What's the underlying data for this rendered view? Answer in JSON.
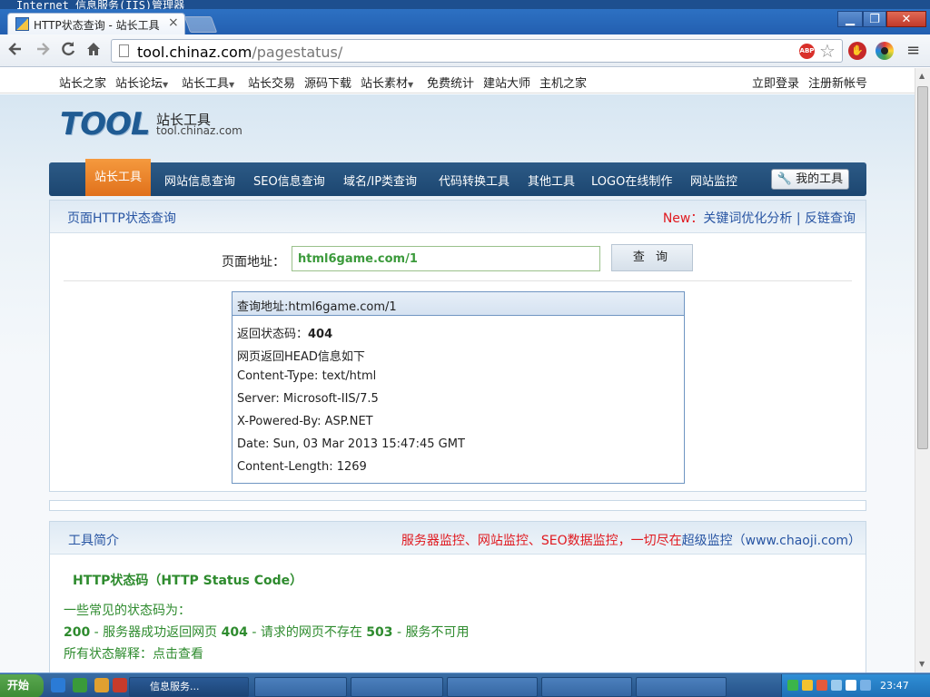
{
  "window": {
    "os_title": "Internet 信息服务(IIS)管理器",
    "minimize": "▁",
    "maximize": "❐",
    "close": "✕"
  },
  "browser": {
    "tab_title": "HTTP状态查询 - 站长工具",
    "tab_close": "×",
    "url_host": "tool.chinaz.com",
    "url_path": "/pagestatus/",
    "abp_label": "ABP",
    "icons": {
      "back": "arrow-left-icon",
      "forward": "arrow-right-icon",
      "reload": "reload-icon",
      "home": "home-icon",
      "bookmark": "star-icon",
      "menu": "menu-icon"
    }
  },
  "topnav": {
    "items": [
      "站长之家",
      "站长论坛",
      "站长工具",
      "站长交易",
      "源码下载",
      "站长素材",
      "免费统计",
      "建站大师",
      "主机之家"
    ],
    "login": "立即登录",
    "register": "注册新帐号"
  },
  "logo": {
    "text": "TOOL",
    "cn": "站长工具",
    "domain": "tool.chinaz.com"
  },
  "mainnav": {
    "active": "站长工具",
    "items": [
      "网站信息查询",
      "SEO信息查询",
      "域名/IP类查询",
      "代码转换工具",
      "其他工具",
      "LOGO在线制作",
      "网站监控"
    ],
    "my_tools": "我的工具"
  },
  "query_panel": {
    "title": "页面HTTP状态查询",
    "new_label": "New",
    "link1": "关键词优化分析",
    "separator": "|",
    "link2": "反链查询",
    "url_label": "页面地址：",
    "url_value": "html6game.com/1",
    "query_button": "查 询"
  },
  "result": {
    "header": "查询地址:html6game.com/1",
    "status_label": "返回状态码：",
    "status_code": "404",
    "head_info": "网页返回HEAD信息如下",
    "lines": [
      "Content-Type: text/html",
      "Server: Microsoft-IIS/7.5",
      "X-Powered-By: ASP.NET",
      "Date: Sun, 03 Mar 2013 15:47:45 GMT",
      "Content-Length: 1269"
    ]
  },
  "intro": {
    "title": "工具简介",
    "promo_pre": "服务器监控、网站监控、SEO数据监控，一切尽在",
    "promo_link": "超级监控",
    "promo_url": "（www.chaoji.com）",
    "heading": "HTTP状态码（HTTP Status Code）",
    "common_label": "一些常见的状态码为：",
    "code_200": "200",
    "desc_200": " - 服务器成功返回网页 ",
    "code_404": "404",
    "desc_404": " - 请求的网页不存在 ",
    "code_503": "503",
    "desc_503": " - 服务不可用",
    "all_label": "所有状态解释：",
    "all_link": "点击查看"
  },
  "taskbar": {
    "start": "开始",
    "buttons": [
      "信息服务...",
      "",
      "",
      "",
      "",
      ""
    ],
    "clock": "23:47"
  }
}
